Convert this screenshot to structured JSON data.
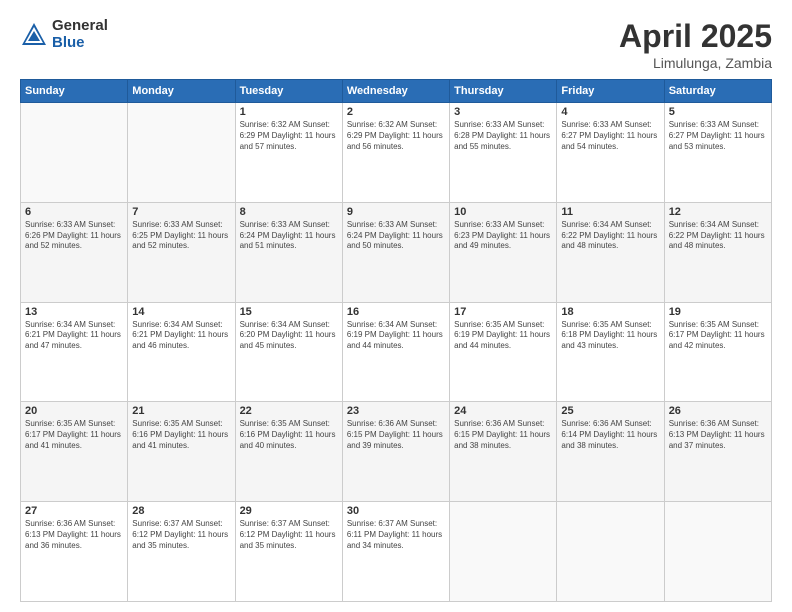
{
  "header": {
    "logo_general": "General",
    "logo_blue": "Blue",
    "title": "April 2025",
    "location": "Limulunga, Zambia"
  },
  "days_of_week": [
    "Sunday",
    "Monday",
    "Tuesday",
    "Wednesday",
    "Thursday",
    "Friday",
    "Saturday"
  ],
  "weeks": [
    [
      {
        "day": "",
        "info": ""
      },
      {
        "day": "",
        "info": ""
      },
      {
        "day": "1",
        "info": "Sunrise: 6:32 AM\nSunset: 6:29 PM\nDaylight: 11 hours\nand 57 minutes."
      },
      {
        "day": "2",
        "info": "Sunrise: 6:32 AM\nSunset: 6:29 PM\nDaylight: 11 hours\nand 56 minutes."
      },
      {
        "day": "3",
        "info": "Sunrise: 6:33 AM\nSunset: 6:28 PM\nDaylight: 11 hours\nand 55 minutes."
      },
      {
        "day": "4",
        "info": "Sunrise: 6:33 AM\nSunset: 6:27 PM\nDaylight: 11 hours\nand 54 minutes."
      },
      {
        "day": "5",
        "info": "Sunrise: 6:33 AM\nSunset: 6:27 PM\nDaylight: 11 hours\nand 53 minutes."
      }
    ],
    [
      {
        "day": "6",
        "info": "Sunrise: 6:33 AM\nSunset: 6:26 PM\nDaylight: 11 hours\nand 52 minutes."
      },
      {
        "day": "7",
        "info": "Sunrise: 6:33 AM\nSunset: 6:25 PM\nDaylight: 11 hours\nand 52 minutes."
      },
      {
        "day": "8",
        "info": "Sunrise: 6:33 AM\nSunset: 6:24 PM\nDaylight: 11 hours\nand 51 minutes."
      },
      {
        "day": "9",
        "info": "Sunrise: 6:33 AM\nSunset: 6:24 PM\nDaylight: 11 hours\nand 50 minutes."
      },
      {
        "day": "10",
        "info": "Sunrise: 6:33 AM\nSunset: 6:23 PM\nDaylight: 11 hours\nand 49 minutes."
      },
      {
        "day": "11",
        "info": "Sunrise: 6:34 AM\nSunset: 6:22 PM\nDaylight: 11 hours\nand 48 minutes."
      },
      {
        "day": "12",
        "info": "Sunrise: 6:34 AM\nSunset: 6:22 PM\nDaylight: 11 hours\nand 48 minutes."
      }
    ],
    [
      {
        "day": "13",
        "info": "Sunrise: 6:34 AM\nSunset: 6:21 PM\nDaylight: 11 hours\nand 47 minutes."
      },
      {
        "day": "14",
        "info": "Sunrise: 6:34 AM\nSunset: 6:21 PM\nDaylight: 11 hours\nand 46 minutes."
      },
      {
        "day": "15",
        "info": "Sunrise: 6:34 AM\nSunset: 6:20 PM\nDaylight: 11 hours\nand 45 minutes."
      },
      {
        "day": "16",
        "info": "Sunrise: 6:34 AM\nSunset: 6:19 PM\nDaylight: 11 hours\nand 44 minutes."
      },
      {
        "day": "17",
        "info": "Sunrise: 6:35 AM\nSunset: 6:19 PM\nDaylight: 11 hours\nand 44 minutes."
      },
      {
        "day": "18",
        "info": "Sunrise: 6:35 AM\nSunset: 6:18 PM\nDaylight: 11 hours\nand 43 minutes."
      },
      {
        "day": "19",
        "info": "Sunrise: 6:35 AM\nSunset: 6:17 PM\nDaylight: 11 hours\nand 42 minutes."
      }
    ],
    [
      {
        "day": "20",
        "info": "Sunrise: 6:35 AM\nSunset: 6:17 PM\nDaylight: 11 hours\nand 41 minutes."
      },
      {
        "day": "21",
        "info": "Sunrise: 6:35 AM\nSunset: 6:16 PM\nDaylight: 11 hours\nand 41 minutes."
      },
      {
        "day": "22",
        "info": "Sunrise: 6:35 AM\nSunset: 6:16 PM\nDaylight: 11 hours\nand 40 minutes."
      },
      {
        "day": "23",
        "info": "Sunrise: 6:36 AM\nSunset: 6:15 PM\nDaylight: 11 hours\nand 39 minutes."
      },
      {
        "day": "24",
        "info": "Sunrise: 6:36 AM\nSunset: 6:15 PM\nDaylight: 11 hours\nand 38 minutes."
      },
      {
        "day": "25",
        "info": "Sunrise: 6:36 AM\nSunset: 6:14 PM\nDaylight: 11 hours\nand 38 minutes."
      },
      {
        "day": "26",
        "info": "Sunrise: 6:36 AM\nSunset: 6:13 PM\nDaylight: 11 hours\nand 37 minutes."
      }
    ],
    [
      {
        "day": "27",
        "info": "Sunrise: 6:36 AM\nSunset: 6:13 PM\nDaylight: 11 hours\nand 36 minutes."
      },
      {
        "day": "28",
        "info": "Sunrise: 6:37 AM\nSunset: 6:12 PM\nDaylight: 11 hours\nand 35 minutes."
      },
      {
        "day": "29",
        "info": "Sunrise: 6:37 AM\nSunset: 6:12 PM\nDaylight: 11 hours\nand 35 minutes."
      },
      {
        "day": "30",
        "info": "Sunrise: 6:37 AM\nSunset: 6:11 PM\nDaylight: 11 hours\nand 34 minutes."
      },
      {
        "day": "",
        "info": ""
      },
      {
        "day": "",
        "info": ""
      },
      {
        "day": "",
        "info": ""
      }
    ]
  ]
}
